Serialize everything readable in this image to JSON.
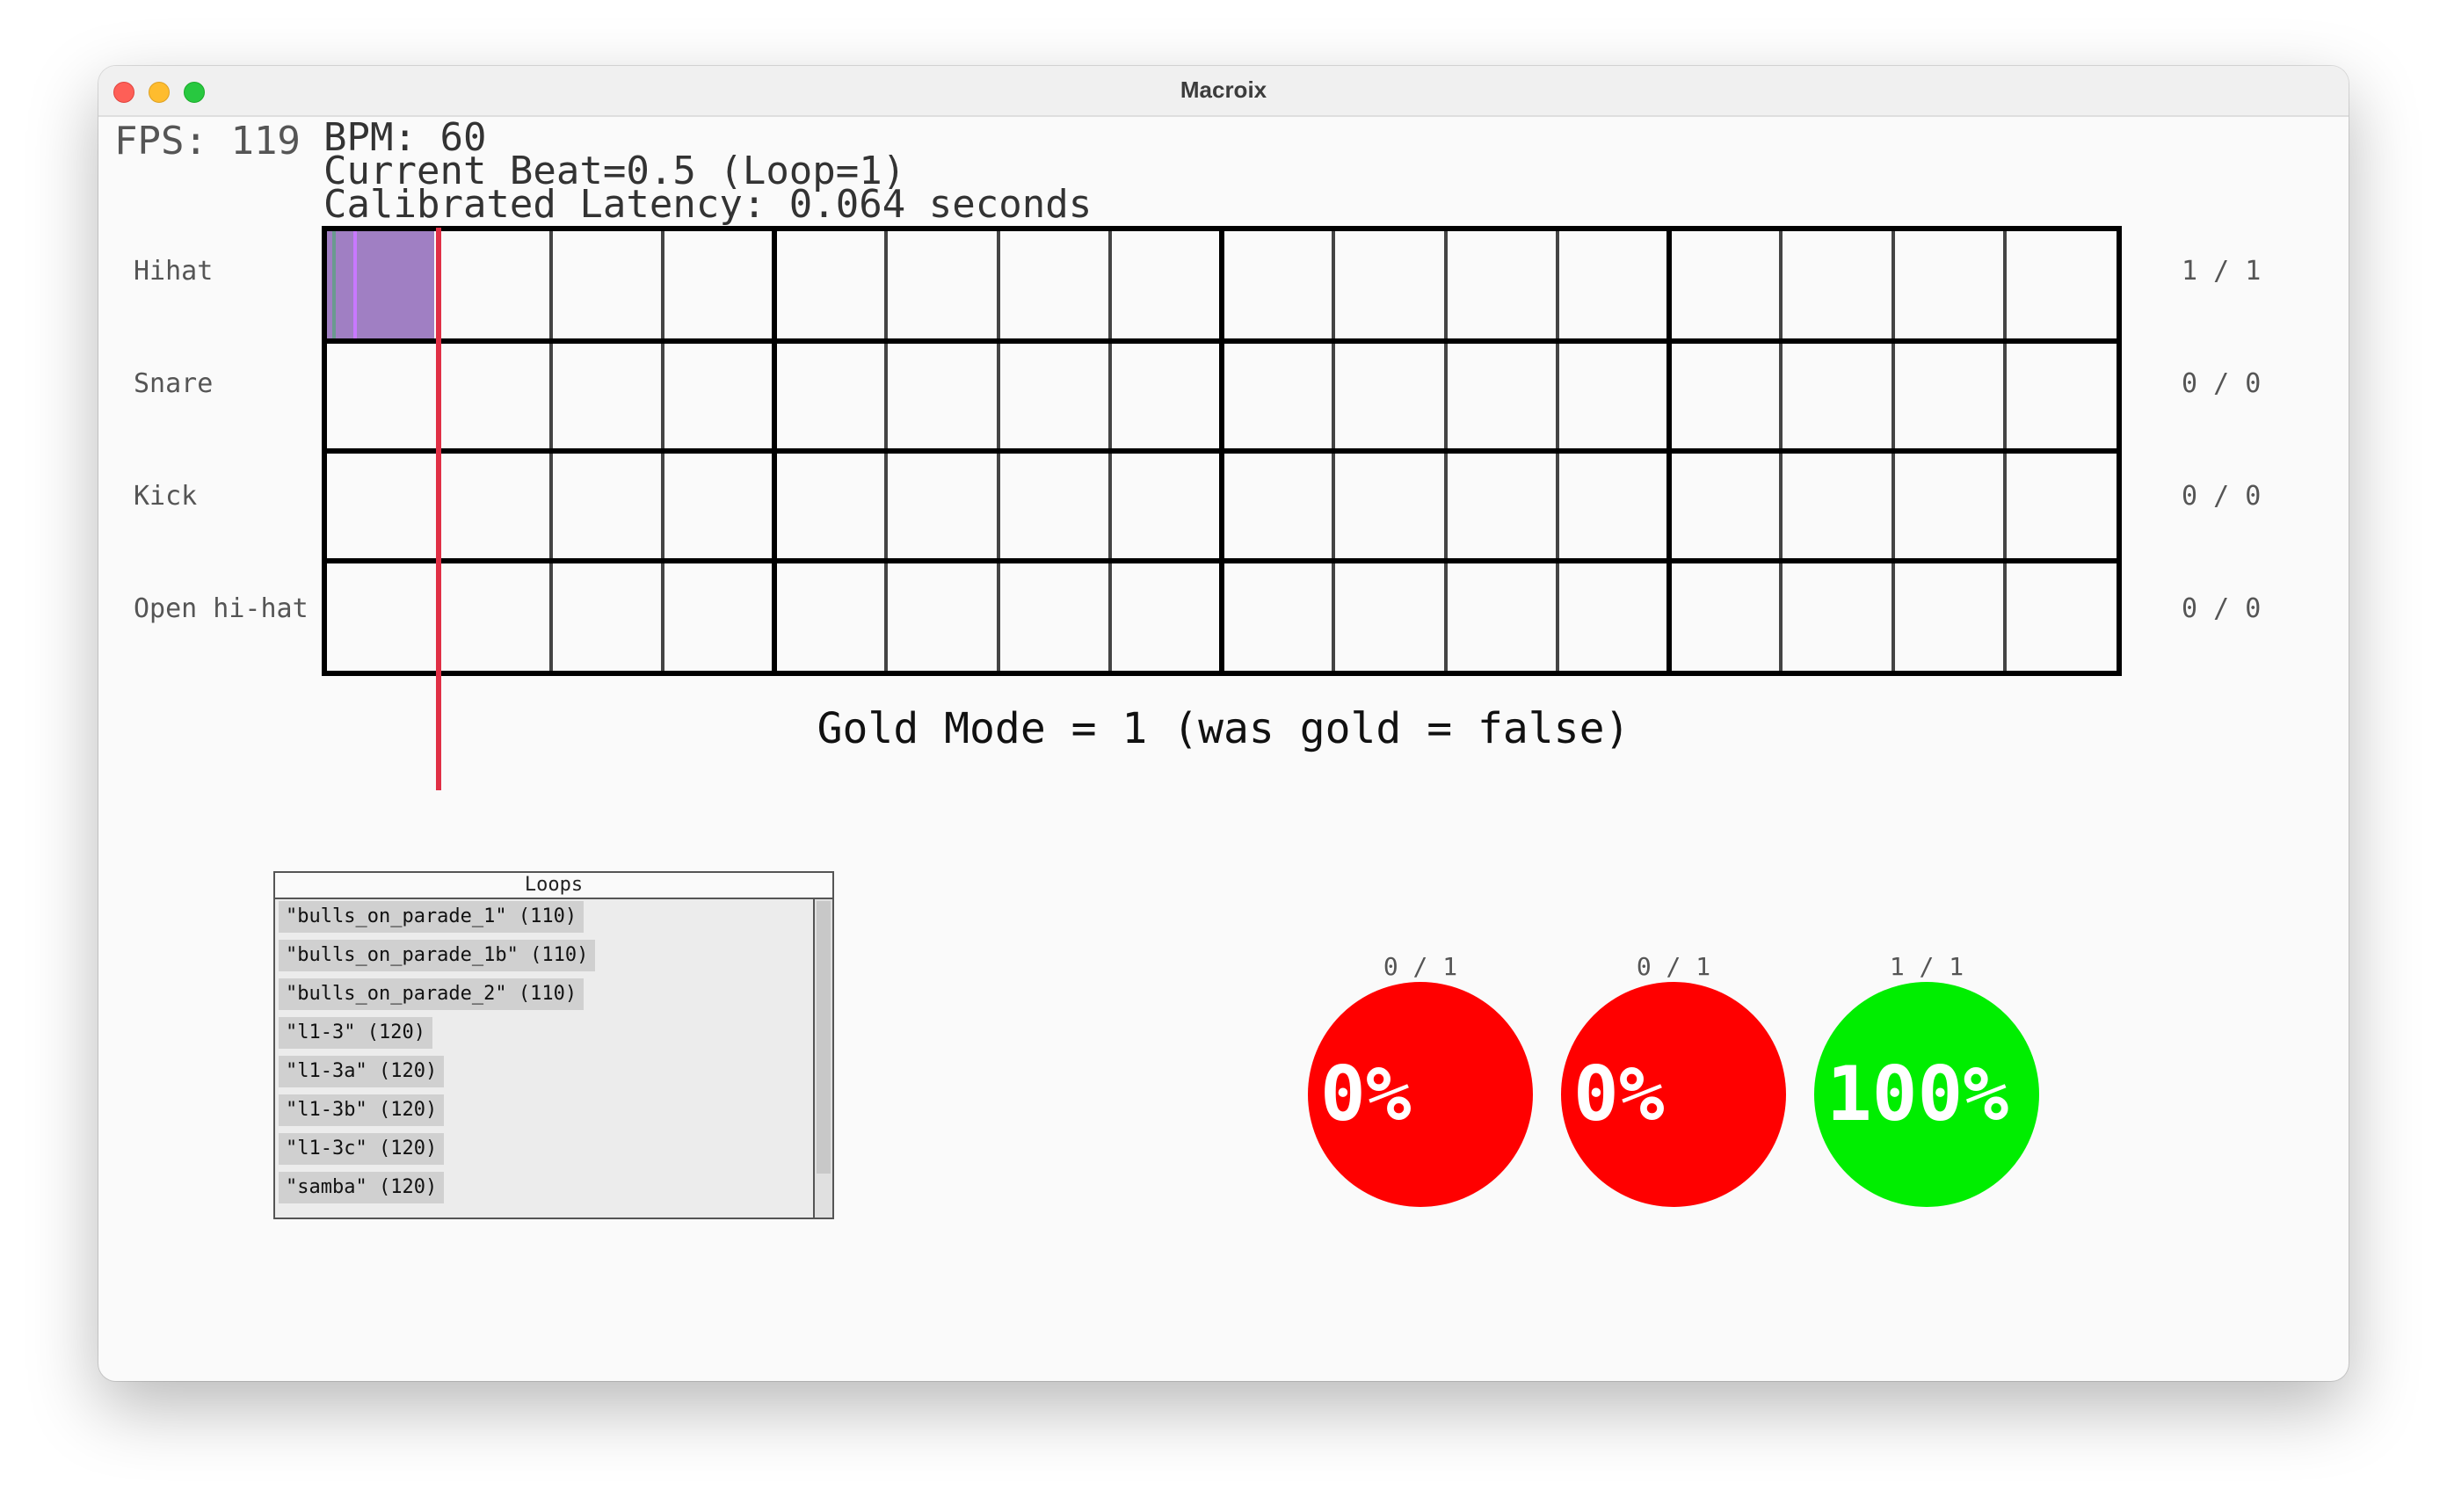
{
  "window": {
    "title": "Macroix"
  },
  "hud": {
    "fps": "FPS: 119",
    "bpm": "BPM: 60",
    "current_beat": "Current Beat=0.5 (Loop=1)",
    "latency": "Calibrated Latency: 0.064 seconds"
  },
  "tracks": [
    {
      "label": "Hihat",
      "count": "1 / 1"
    },
    {
      "label": "Snare",
      "count": "0 / 0"
    },
    {
      "label": "Kick",
      "count": "0 / 0"
    },
    {
      "label": "Open hi-hat",
      "count": "0 / 0"
    }
  ],
  "grid": {
    "rows": 4,
    "steps": 16,
    "hits": [
      {
        "row": 0,
        "step": 0
      }
    ]
  },
  "colors": {
    "hit": "#a07fc3",
    "playhead": "#e02f45",
    "miss": "#ff0000",
    "perfect": "#00ee00"
  },
  "gold_mode": "Gold Mode = 1 (was gold = false)",
  "loops": {
    "title": "Loops",
    "items": [
      "\"bulls_on_parade_1\" (110)",
      "\"bulls_on_parade_1b\" (110)",
      "\"bulls_on_parade_2\" (110)",
      "\"l1-3\" (120)",
      "\"l1-3a\" (120)",
      "\"l1-3b\" (120)",
      "\"l1-3c\" (120)",
      "\"samba\" (120)"
    ]
  },
  "meters": [
    {
      "label": "0 / 1",
      "value": "0%",
      "color": "#ff0000"
    },
    {
      "label": "0 / 1",
      "value": "0%",
      "color": "#ff0000"
    },
    {
      "label": "1 / 1",
      "value": "100%",
      "color": "#00ee00"
    }
  ]
}
